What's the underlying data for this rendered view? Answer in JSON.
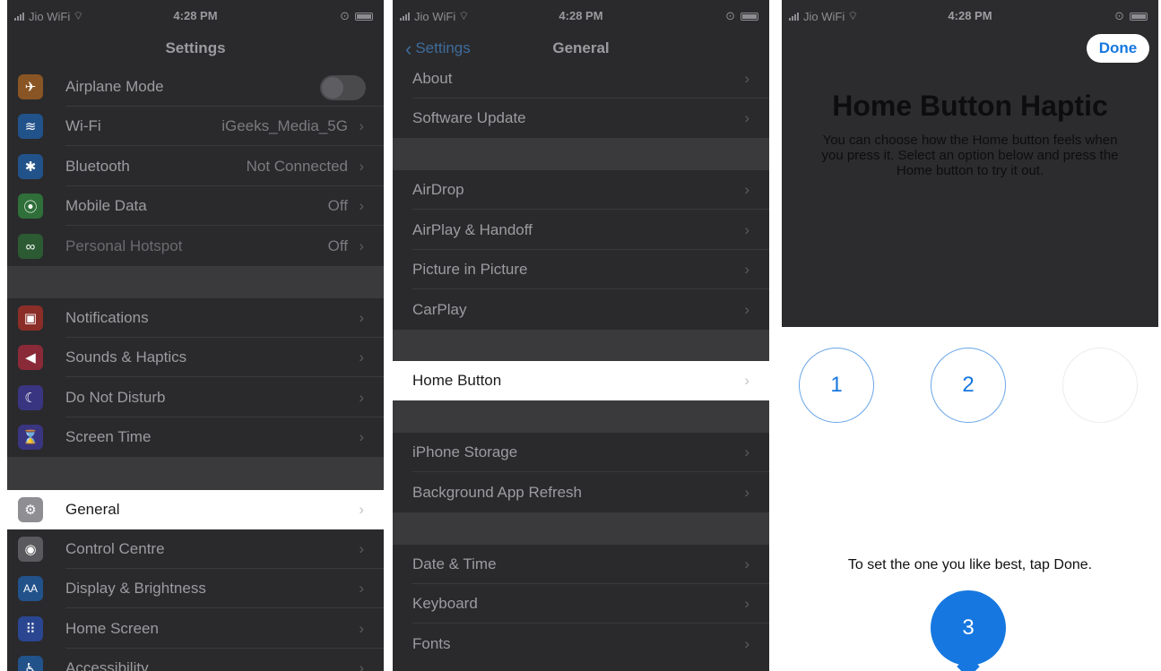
{
  "status": {
    "carrier": "Jio WiFi",
    "time": "4:28 PM"
  },
  "settings": {
    "title": "Settings",
    "items": [
      {
        "label": "Airplane Mode",
        "value": "",
        "icon": "airplane-icon",
        "color": "#e8832a"
      },
      {
        "label": "Wi-Fi",
        "value": "iGeeks_Media_5G",
        "icon": "wifi-icon",
        "color": "#2f84e8"
      },
      {
        "label": "Bluetooth",
        "value": "Not Connected",
        "icon": "bluetooth-icon",
        "color": "#2f84e8"
      },
      {
        "label": "Mobile Data",
        "value": "Off",
        "icon": "antenna-icon",
        "color": "#4cb55c"
      },
      {
        "label": "Personal Hotspot",
        "value": "Off",
        "icon": "hotspot-icon",
        "color": "#4cb55c"
      },
      {
        "label": "Notifications",
        "value": "",
        "icon": "notifications-icon",
        "color": "#e84a3d"
      },
      {
        "label": "Sounds & Haptics",
        "value": "",
        "icon": "speaker-icon",
        "color": "#e8445c"
      },
      {
        "label": "Do Not Disturb",
        "value": "",
        "icon": "moon-icon",
        "color": "#5b52d6"
      },
      {
        "label": "Screen Time",
        "value": "",
        "icon": "hourglass-icon",
        "color": "#5b52d6"
      },
      {
        "label": "General",
        "value": "",
        "icon": "gear-icon",
        "color": "#8e8e93"
      },
      {
        "label": "Control Centre",
        "value": "",
        "icon": "toggles-icon",
        "color": "#8e8e93"
      },
      {
        "label": "Display & Brightness",
        "value": "",
        "icon": "text-size-icon",
        "color": "#2f84e8"
      },
      {
        "label": "Home Screen",
        "value": "",
        "icon": "grid-icon",
        "color": "#3d6fe0"
      },
      {
        "label": "Accessibility",
        "value": "",
        "icon": "accessibility-icon",
        "color": "#2f84e8"
      }
    ]
  },
  "general": {
    "back_label": "Settings",
    "title": "General",
    "items": [
      {
        "label": "About"
      },
      {
        "label": "Software Update"
      },
      {
        "label": "AirDrop"
      },
      {
        "label": "AirPlay & Handoff"
      },
      {
        "label": "Picture in Picture"
      },
      {
        "label": "CarPlay"
      },
      {
        "label": "Home Button"
      },
      {
        "label": "iPhone Storage"
      },
      {
        "label": "Background App Refresh"
      },
      {
        "label": "Date & Time"
      },
      {
        "label": "Keyboard"
      },
      {
        "label": "Fonts"
      }
    ]
  },
  "haptic": {
    "done_label": "Done",
    "title": "Home Button Haptic",
    "description": "You can choose how the Home button feels when you press it. Select an option below and press the Home button to try it out.",
    "options": [
      "1",
      "2",
      "3"
    ],
    "selected_option": "3",
    "prompt": "To set the one you like best, tap Done."
  }
}
